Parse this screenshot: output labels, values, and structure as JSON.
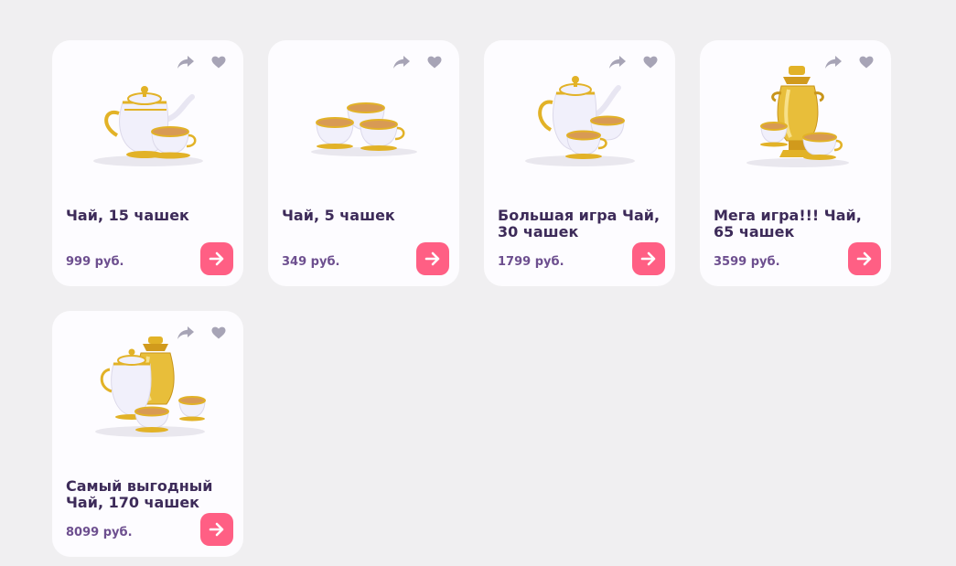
{
  "colors": {
    "background": "#f0eff1",
    "card": "#fdfcff",
    "title": "#3d2b59",
    "price": "#6d4f8f",
    "button": "#ff5f84",
    "icon": "#a7a4b6",
    "gold": "#e2b227",
    "porcelain": "#f1f0fb",
    "tea": "#d89a54"
  },
  "products": [
    {
      "title": "Чай, 15 чашек",
      "price": "999 руб.",
      "image": "teapot-with-cups"
    },
    {
      "title": "Чай, 5 чашек",
      "price": "349 руб.",
      "image": "three-cups"
    },
    {
      "title": "Большая игра Чай, 30 чашек",
      "price": "1799 руб.",
      "image": "teapot-with-cups"
    },
    {
      "title": "Мега игра!!! Чай, 65 чашек",
      "price": "3599 руб.",
      "image": "samovar-with-cups"
    },
    {
      "title": "Самый выгодный Чай, 170 чашек",
      "price": "8099 руб.",
      "image": "samovar-teapot-cups"
    }
  ]
}
